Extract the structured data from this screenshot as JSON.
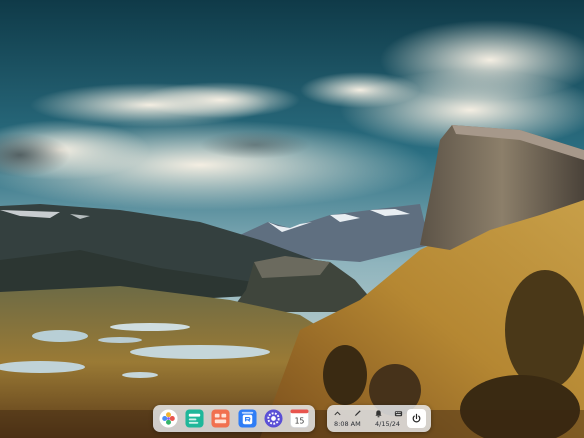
{
  "desktop": {
    "wallpaper": "mountain-valley-landscape"
  },
  "dock": {
    "apps": [
      {
        "name": "launcher",
        "icon": "launcher-icon"
      },
      {
        "name": "multitasking-view",
        "icon": "multitasking-icon"
      },
      {
        "name": "file-manager",
        "icon": "folder-icon"
      },
      {
        "name": "app-store",
        "icon": "app-store-icon"
      },
      {
        "name": "settings",
        "icon": "gear-icon"
      },
      {
        "name": "calendar",
        "icon": "calendar-icon",
        "day": "15"
      }
    ]
  },
  "tray": {
    "icons": [
      "chevron-up-icon",
      "pen-icon",
      "notification-bell-icon",
      "keyboard-icon"
    ],
    "time": "8:08 AM",
    "date": "4/15/24",
    "power_icon": "power-icon"
  },
  "colors": {
    "panel_bg": "#ebeef2",
    "accent_blue": "#2f7df6",
    "settings_purple": "#5a4fd6",
    "multitask_teal": "#1fb79a",
    "folder_orange": "#f1704f"
  }
}
